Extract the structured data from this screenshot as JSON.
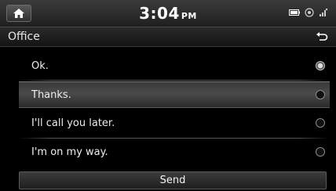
{
  "status": {
    "time": "3:04",
    "ampm": "PM",
    "icons": [
      "home-icon",
      "battery-icon",
      "signal-icon",
      "network-icon"
    ]
  },
  "header": {
    "title": "Office",
    "back_icon": "back-arrow-icon"
  },
  "messages": {
    "items": [
      {
        "label": "Ok.",
        "state": "checked"
      },
      {
        "label": "Thanks.",
        "state": "highlighted"
      },
      {
        "label": "I'll call you later.",
        "state": "unchecked"
      },
      {
        "label": "I'm on my way.",
        "state": "unchecked"
      }
    ]
  },
  "actions": {
    "send_label": "Send"
  }
}
